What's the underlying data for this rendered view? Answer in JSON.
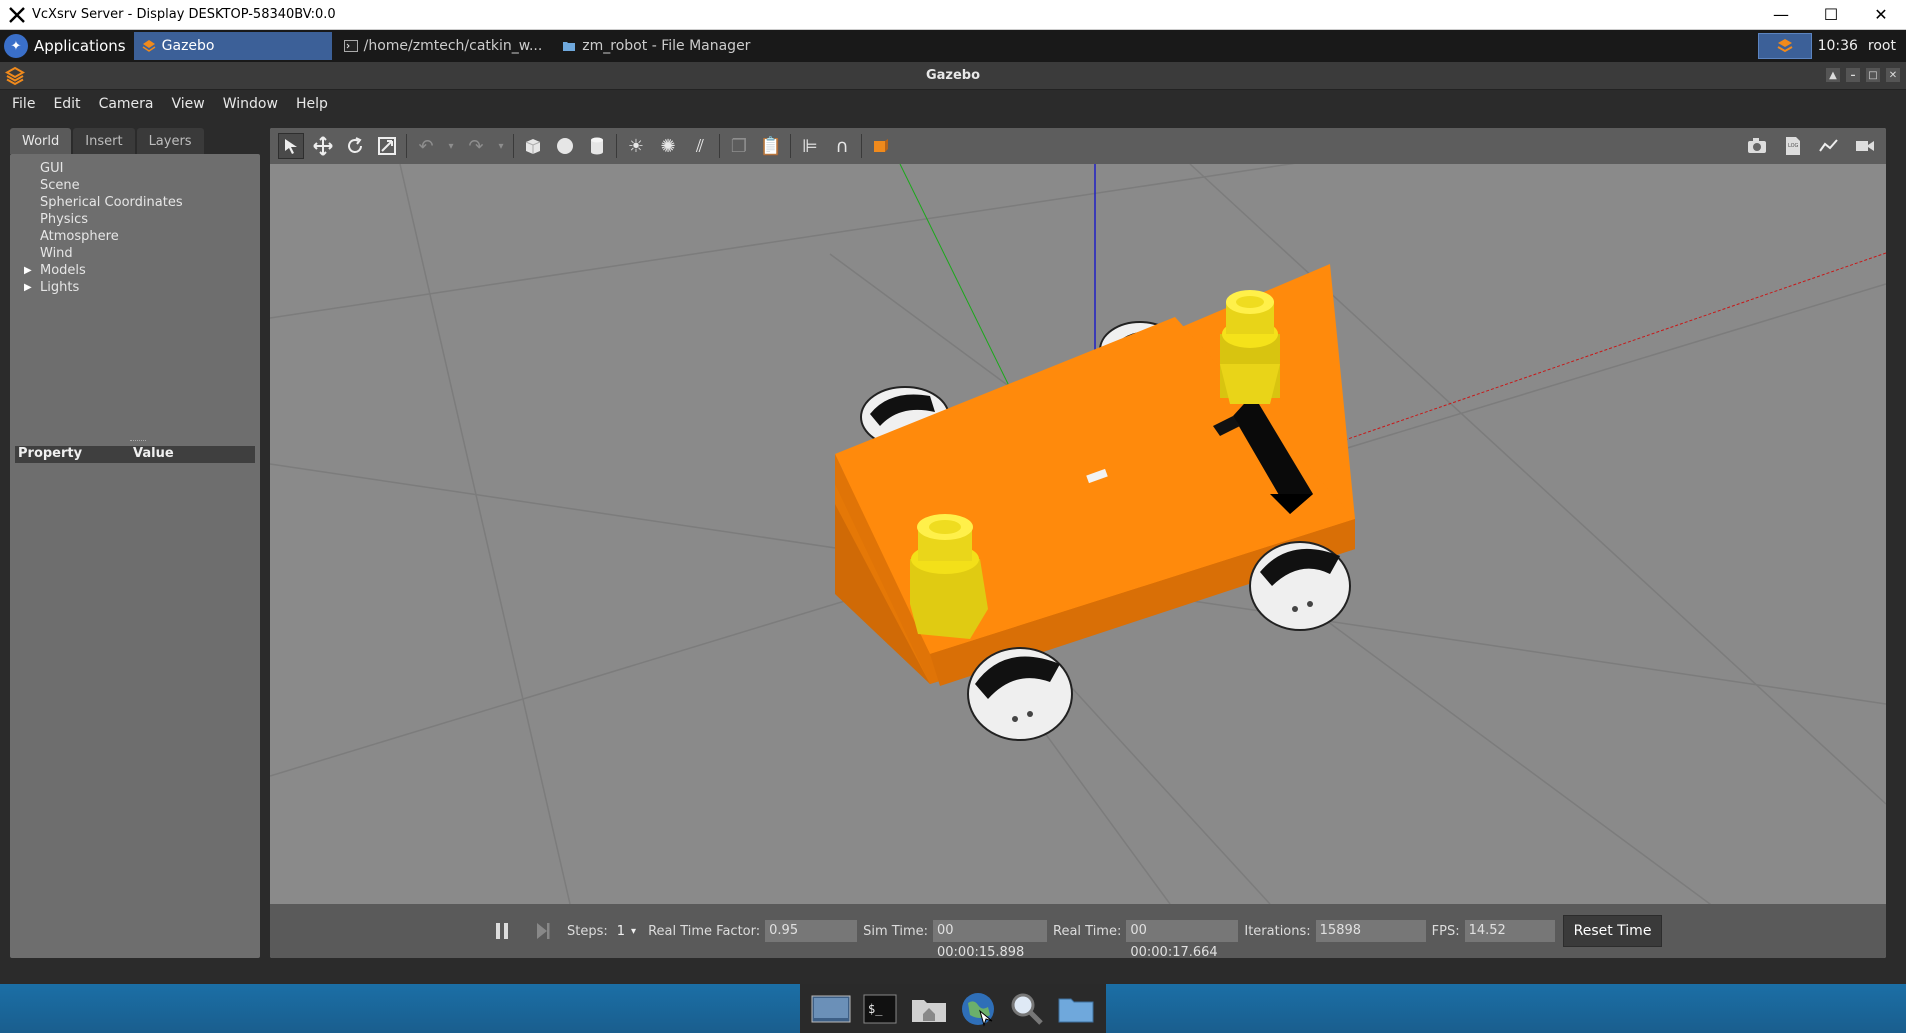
{
  "window": {
    "title": "VcXsrv Server - Display DESKTOP-58340BV:0.0",
    "minimize": "—",
    "maximize": "☐",
    "close": "✕"
  },
  "panel": {
    "applications_label": "Applications",
    "tasks": [
      {
        "label": "Gazebo",
        "active": true
      },
      {
        "label": "/home/zmtech/catkin_w...",
        "active": false
      },
      {
        "label": "zm_robot - File Manager",
        "active": false
      }
    ],
    "clock": "10:36",
    "user": "root"
  },
  "gazebo": {
    "title": "Gazebo",
    "menu": [
      "File",
      "Edit",
      "Camera",
      "View",
      "Window",
      "Help"
    ],
    "tabs": [
      "World",
      "Insert",
      "Layers"
    ],
    "tree_items": [
      {
        "label": "GUI",
        "expandable": false
      },
      {
        "label": "Scene",
        "expandable": false
      },
      {
        "label": "Spherical Coordinates",
        "expandable": false
      },
      {
        "label": "Physics",
        "expandable": false
      },
      {
        "label": "Atmosphere",
        "expandable": false
      },
      {
        "label": "Wind",
        "expandable": false
      },
      {
        "label": "Models",
        "expandable": true
      },
      {
        "label": "Lights",
        "expandable": true
      }
    ],
    "property_header": {
      "property": "Property",
      "value": "Value"
    },
    "bottom": {
      "steps_label": "Steps:",
      "steps_value": "1",
      "rtf_label": "Real Time Factor:",
      "rtf_value": "0.95",
      "sim_label": "Sim Time:",
      "sim_value": "00 00:00:15.898",
      "real_label": "Real Time:",
      "real_value": "00 00:00:17.664",
      "iter_label": "Iterations:",
      "iter_value": "15898",
      "fps_label": "FPS:",
      "fps_value": "14.52",
      "reset_label": "Reset Time"
    }
  },
  "colors": {
    "robot_body": "#ff8a0c",
    "lidar": "#f5e21a",
    "ground": "#8a8a8a",
    "accent": "#3c6098"
  }
}
